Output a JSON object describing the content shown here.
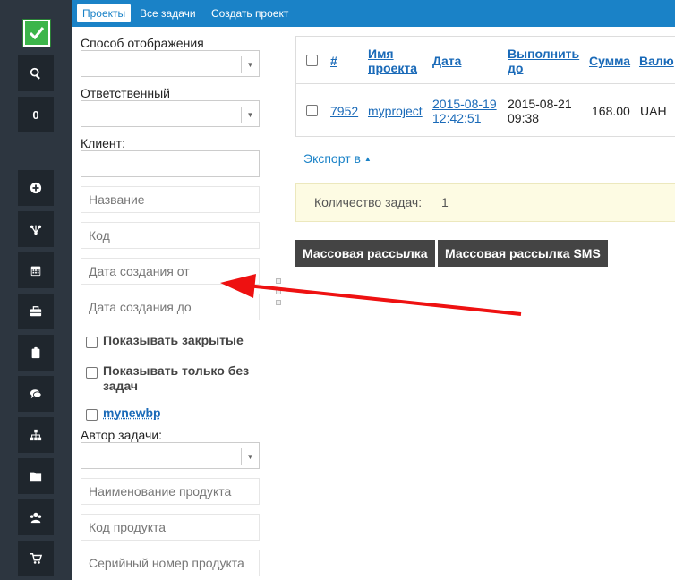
{
  "tabs": [
    "Проекты",
    "Все задачи",
    "Создать проект"
  ],
  "rail": {
    "counter": "0",
    "icons": [
      "search-icon",
      "plus-circle-icon",
      "branch-icon",
      "calendar-icon",
      "briefcase-icon",
      "clipboard-icon",
      "comments-icon",
      "sitemap-icon",
      "folder-icon",
      "users-icon",
      "cart-icon"
    ]
  },
  "filters": {
    "display_mode_label": "Способ отображения",
    "responsible_label": "Ответственный",
    "client_label": "Клиент:",
    "name_placeholder": "Название",
    "code_placeholder": "Код",
    "created_from_placeholder": "Дата создания от",
    "created_to_placeholder": "Дата создания до",
    "show_closed": "Показывать закрытые",
    "show_without_tasks_line1": "Показывать только без",
    "show_without_tasks_line2": "задач",
    "bp_link": "mynewbp",
    "author_label": "Автор задачи:",
    "product_name_placeholder": "Наименование продукта",
    "product_code_placeholder": "Код продукта",
    "serial_placeholder": "Серийный номер продукта"
  },
  "table": {
    "headers": {
      "id": "#",
      "name_1": "Имя",
      "name_2": "проекта",
      "date": "Дата",
      "due_1": "Выполнить",
      "due_2": "до",
      "sum": "Сумма",
      "currency": "Валю"
    },
    "row": {
      "id": "7952",
      "name": "myproject",
      "date_1": "2015-08-19",
      "date_2": "12:42:51",
      "due_1": "2015-08-21",
      "due_2": "09:38",
      "sum": "168.00",
      "currency": "UAH"
    }
  },
  "export_label": "Экспорт в",
  "summary": {
    "label": "Количество задач:",
    "value": "1"
  },
  "buttons": {
    "mass_mail": "Массовая рассылка",
    "mass_sms": "Массовая рассылка SMS"
  },
  "colors": {
    "topbar": "#1a82c7",
    "rail": "#2d3640",
    "arrow": "#ee1111",
    "logo": "#3cb54a"
  }
}
